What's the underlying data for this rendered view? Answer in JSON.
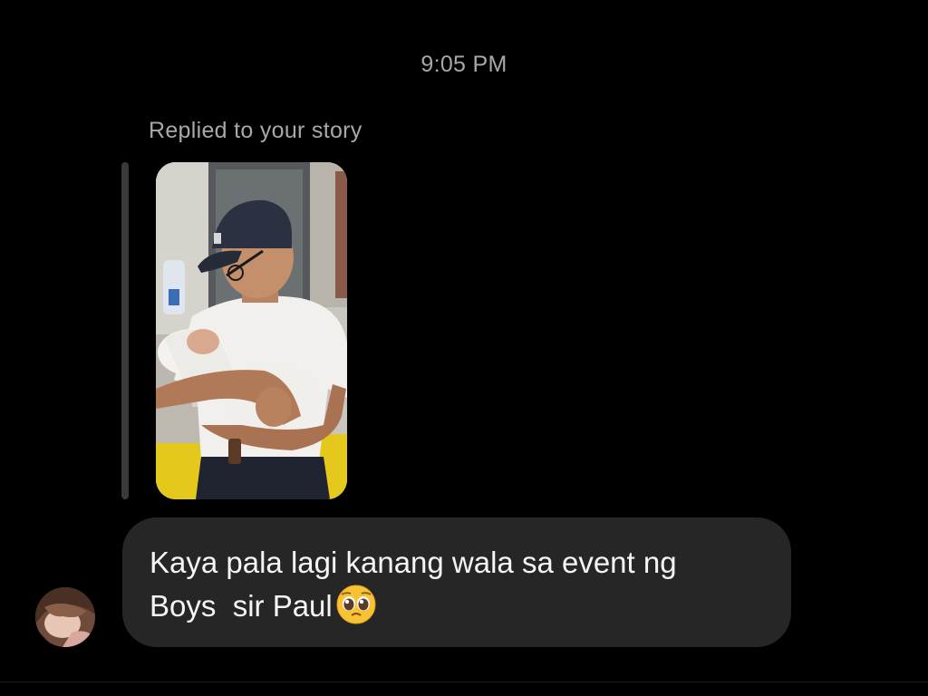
{
  "thread": {
    "timestamp": "9:05 PM",
    "reply_context": "Replied to your story",
    "message": {
      "text": "Kaya pala lagi kanang wala sa event ng\nBoys  sir Paul",
      "emoji": "pleading-face-emoji"
    },
    "colors": {
      "background": "#000000",
      "bubble": "#262626",
      "secondary_text": "#a8a8a8",
      "primary_text": "#f5f5f5"
    }
  }
}
